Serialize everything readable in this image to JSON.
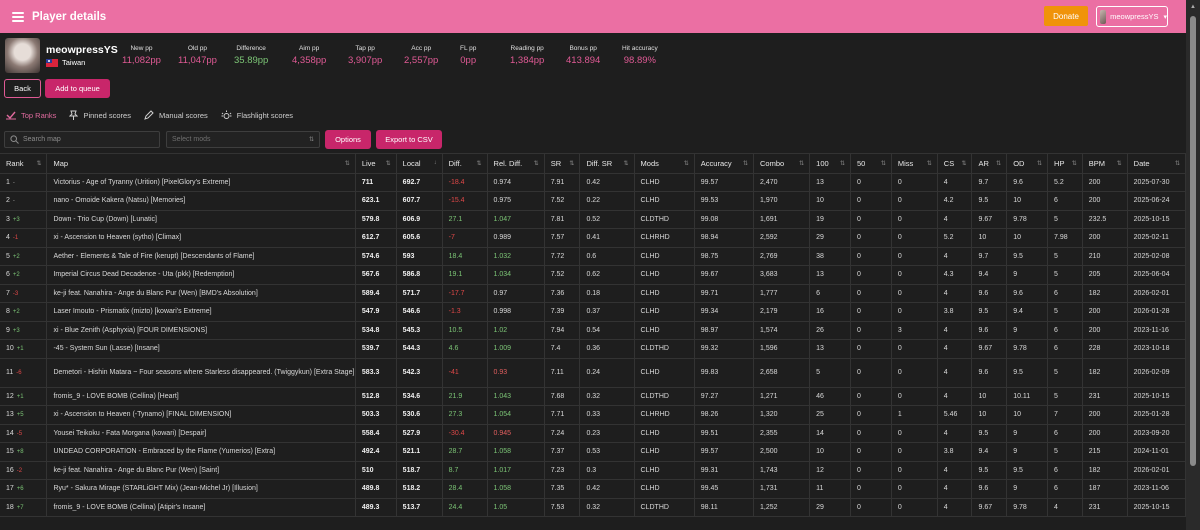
{
  "header": {
    "title": "Player details",
    "donate_label": "Donate",
    "user_label": "meowpressYS"
  },
  "profile": {
    "username": "meowpressYS",
    "country": "Taiwan",
    "stats": [
      {
        "label": "New pp",
        "value": "11,082pp",
        "tone": "pink"
      },
      {
        "label": "Old pp",
        "value": "11,047pp",
        "tone": "pink"
      },
      {
        "label": "Difference",
        "value": "35.89pp",
        "tone": "green"
      },
      {
        "label": "Aim pp",
        "value": "4,358pp",
        "tone": "pink"
      },
      {
        "label": "Tap pp",
        "value": "3,907pp",
        "tone": "pink"
      },
      {
        "label": "Acc pp",
        "value": "2,557pp",
        "tone": "pink"
      },
      {
        "label": "FL pp",
        "value": "0pp",
        "tone": "pink"
      },
      {
        "label": "Reading pp",
        "value": "1,384pp",
        "tone": "pink"
      },
      {
        "label": "Bonus pp",
        "value": "413.894",
        "tone": "pink"
      },
      {
        "label": "Hit accuracy",
        "value": "98.89%",
        "tone": "pink"
      }
    ]
  },
  "actions": {
    "back_label": "Back",
    "queue_label": "Add to queue"
  },
  "tabs": [
    {
      "label": "Top Ranks",
      "icon": "top-ranks-icon",
      "active": true
    },
    {
      "label": "Pinned scores",
      "icon": "pin-icon",
      "active": false
    },
    {
      "label": "Manual scores",
      "icon": "pencil-icon",
      "active": false
    },
    {
      "label": "Flashlight scores",
      "icon": "flashlight-icon",
      "active": false
    }
  ],
  "toolbar": {
    "search_placeholder": "Search map",
    "mods_placeholder": "Select mods",
    "options_label": "Options",
    "export_label": "Export to CSV"
  },
  "table": {
    "columns": [
      "Rank",
      "Map",
      "Live",
      "Local",
      "Diff.",
      "Rel. Diff.",
      "SR",
      "Diff. SR",
      "Mods",
      "Accuracy",
      "Combo",
      "100",
      "50",
      "Miss",
      "CS",
      "AR",
      "OD",
      "HP",
      "BPM",
      "Date"
    ],
    "rows": [
      {
        "rank": "1",
        "delta": "-",
        "dir": "same",
        "map": "Victorius - Age of Tyranny (Urition) [PixelGlory's Extreme]",
        "live": "711",
        "local": "692.7",
        "diff": "-18.4",
        "rel": "0.974",
        "sr": "7.91",
        "dsr": "0.42",
        "mods": "CLHD",
        "acc": "99.57",
        "combo": "2,470",
        "c100": "13",
        "c50": "0",
        "miss": "0",
        "cs": "4",
        "ar": "9.7",
        "od": "9.6",
        "hp": "5.2",
        "bpm": "200",
        "date": "2025-07-30"
      },
      {
        "rank": "2",
        "delta": "-",
        "dir": "same",
        "map": "nano - Omoide Kakera (Natsu) [Memories]",
        "live": "623.1",
        "local": "607.7",
        "diff": "-15.4",
        "rel": "0.975",
        "sr": "7.52",
        "dsr": "0.22",
        "mods": "CLHD",
        "acc": "99.53",
        "combo": "1,970",
        "c100": "10",
        "c50": "0",
        "miss": "0",
        "cs": "4.2",
        "ar": "9.5",
        "od": "10",
        "hp": "6",
        "bpm": "200",
        "date": "2025-06-24"
      },
      {
        "rank": "3",
        "delta": "+3",
        "dir": "up",
        "map": "Down - Trio Cup (Down) [Lunatic]",
        "live": "579.8",
        "local": "606.9",
        "diff": "27.1",
        "rel": "1.047",
        "sr": "7.81",
        "dsr": "0.52",
        "mods": "CLDTHD",
        "acc": "99.08",
        "combo": "1,691",
        "c100": "19",
        "c50": "0",
        "miss": "0",
        "cs": "4",
        "ar": "9.67",
        "od": "9.78",
        "hp": "5",
        "bpm": "232.5",
        "date": "2025-10-15"
      },
      {
        "rank": "4",
        "delta": "-1",
        "dir": "down",
        "map": "xi - Ascension to Heaven (sytho) [Climax]",
        "live": "612.7",
        "local": "605.6",
        "diff": "-7",
        "rel": "0.989",
        "sr": "7.57",
        "dsr": "0.41",
        "mods": "CLHRHD",
        "acc": "98.94",
        "combo": "2,592",
        "c100": "29",
        "c50": "0",
        "miss": "0",
        "cs": "5.2",
        "ar": "10",
        "od": "10",
        "hp": "7.98",
        "bpm": "200",
        "date": "2025-02-11"
      },
      {
        "rank": "5",
        "delta": "+2",
        "dir": "up",
        "map": "Aether - Elements & Tale of Fire (kerupt) [Descendants of Flame]",
        "live": "574.6",
        "local": "593",
        "diff": "18.4",
        "rel": "1.032",
        "sr": "7.72",
        "dsr": "0.6",
        "mods": "CLHD",
        "acc": "98.75",
        "combo": "2,769",
        "c100": "38",
        "c50": "0",
        "miss": "0",
        "cs": "4",
        "ar": "9.7",
        "od": "9.5",
        "hp": "5",
        "bpm": "210",
        "date": "2025-02-08"
      },
      {
        "rank": "6",
        "delta": "+2",
        "dir": "up",
        "map": "Imperial Circus Dead Decadence - Uta (pkk) [Redemption]",
        "live": "567.6",
        "local": "586.8",
        "diff": "19.1",
        "rel": "1.034",
        "sr": "7.52",
        "dsr": "0.62",
        "mods": "CLHD",
        "acc": "99.67",
        "combo": "3,683",
        "c100": "13",
        "c50": "0",
        "miss": "0",
        "cs": "4.3",
        "ar": "9.4",
        "od": "9",
        "hp": "5",
        "bpm": "205",
        "date": "2025-06-04"
      },
      {
        "rank": "7",
        "delta": "-3",
        "dir": "down",
        "map": "ke-ji feat. Nanahira - Ange du Blanc Pur (Wen) [BMD's Absolution]",
        "live": "589.4",
        "local": "571.7",
        "diff": "-17.7",
        "rel": "0.97",
        "sr": "7.36",
        "dsr": "0.18",
        "mods": "CLHD",
        "acc": "99.71",
        "combo": "1,777",
        "c100": "6",
        "c50": "0",
        "miss": "0",
        "cs": "4",
        "ar": "9.6",
        "od": "9.6",
        "hp": "6",
        "bpm": "182",
        "date": "2026-02-01"
      },
      {
        "rank": "8",
        "delta": "+2",
        "dir": "up",
        "map": "Laser Imouto - Prismatix (mizto) [kowari's Extreme]",
        "live": "547.9",
        "local": "546.6",
        "diff": "-1.3",
        "rel": "0.998",
        "sr": "7.39",
        "dsr": "0.37",
        "mods": "CLHD",
        "acc": "99.34",
        "combo": "2,179",
        "c100": "16",
        "c50": "0",
        "miss": "0",
        "cs": "3.8",
        "ar": "9.5",
        "od": "9.4",
        "hp": "5",
        "bpm": "200",
        "date": "2026-01-28"
      },
      {
        "rank": "9",
        "delta": "+3",
        "dir": "up",
        "map": "xi - Blue Zenith (Asphyxia) [FOUR DIMENSIONS]",
        "live": "534.8",
        "local": "545.3",
        "diff": "10.5",
        "rel": "1.02",
        "sr": "7.94",
        "dsr": "0.54",
        "mods": "CLHD",
        "acc": "98.97",
        "combo": "1,574",
        "c100": "26",
        "c50": "0",
        "miss": "3",
        "cs": "4",
        "ar": "9.6",
        "od": "9",
        "hp": "6",
        "bpm": "200",
        "date": "2023-11-16"
      },
      {
        "rank": "10",
        "delta": "+1",
        "dir": "up",
        "map": "-45 - System Sun (Lasse) [Insane]",
        "live": "539.7",
        "local": "544.3",
        "diff": "4.6",
        "rel": "1.009",
        "sr": "7.4",
        "dsr": "0.36",
        "mods": "CLDTHD",
        "acc": "99.32",
        "combo": "1,596",
        "c100": "13",
        "c50": "0",
        "miss": "0",
        "cs": "4",
        "ar": "9.67",
        "od": "9.78",
        "hp": "6",
        "bpm": "228",
        "date": "2023-10-18"
      },
      {
        "rank": "11",
        "delta": "-6",
        "dir": "down",
        "map": "Demetori - Hishin Matara ~ Four seasons where Starless disappeared. (Twiggykun) [Extra Stage]",
        "live": "583.3",
        "local": "542.3",
        "diff": "-41",
        "rel": "0.93",
        "sr": "7.11",
        "dsr": "0.24",
        "mods": "CLHD",
        "acc": "99.83",
        "combo": "2,658",
        "c100": "5",
        "c50": "0",
        "miss": "0",
        "cs": "4",
        "ar": "9.6",
        "od": "9.5",
        "hp": "5",
        "bpm": "182",
        "date": "2026-02-09",
        "tall": true
      },
      {
        "rank": "12",
        "delta": "+1",
        "dir": "up",
        "map": "fromis_9 - LOVE BOMB (Cellina) [Heart]",
        "live": "512.8",
        "local": "534.6",
        "diff": "21.9",
        "rel": "1.043",
        "sr": "7.68",
        "dsr": "0.32",
        "mods": "CLDTHD",
        "acc": "97.27",
        "combo": "1,271",
        "c100": "46",
        "c50": "0",
        "miss": "0",
        "cs": "4",
        "ar": "10",
        "od": "10.11",
        "hp": "5",
        "bpm": "231",
        "date": "2025-10-15"
      },
      {
        "rank": "13",
        "delta": "+5",
        "dir": "up",
        "map": "xi - Ascension to Heaven (-Tynamo) [FINAL DIMENSION]",
        "live": "503.3",
        "local": "530.6",
        "diff": "27.3",
        "rel": "1.054",
        "sr": "7.71",
        "dsr": "0.33",
        "mods": "CLHRHD",
        "acc": "98.26",
        "combo": "1,320",
        "c100": "25",
        "c50": "0",
        "miss": "1",
        "cs": "5.46",
        "ar": "10",
        "od": "10",
        "hp": "7",
        "bpm": "200",
        "date": "2025-01-28"
      },
      {
        "rank": "14",
        "delta": "-5",
        "dir": "down",
        "map": "Yousei Teikoku - Fata Morgana (kowari) [Despair]",
        "live": "558.4",
        "local": "527.9",
        "diff": "-30.4",
        "rel": "0.945",
        "sr": "7.24",
        "dsr": "0.23",
        "mods": "CLHD",
        "acc": "99.51",
        "combo": "2,355",
        "c100": "14",
        "c50": "0",
        "miss": "0",
        "cs": "4",
        "ar": "9.5",
        "od": "9",
        "hp": "6",
        "bpm": "200",
        "date": "2023-09-20"
      },
      {
        "rank": "15",
        "delta": "+8",
        "dir": "up",
        "map": "UNDEAD CORPORATION - Embraced by the Flame (Yumerios) [Extra]",
        "live": "492.4",
        "local": "521.1",
        "diff": "28.7",
        "rel": "1.058",
        "sr": "7.37",
        "dsr": "0.53",
        "mods": "CLHD",
        "acc": "99.57",
        "combo": "2,500",
        "c100": "10",
        "c50": "0",
        "miss": "0",
        "cs": "3.8",
        "ar": "9.4",
        "od": "9",
        "hp": "5",
        "bpm": "215",
        "date": "2024-11-01"
      },
      {
        "rank": "16",
        "delta": "-2",
        "dir": "down",
        "map": "ke-ji feat. Nanahira - Ange du Blanc Pur (Wen) [Saint]",
        "live": "510",
        "local": "518.7",
        "diff": "8.7",
        "rel": "1.017",
        "sr": "7.23",
        "dsr": "0.3",
        "mods": "CLHD",
        "acc": "99.31",
        "combo": "1,743",
        "c100": "12",
        "c50": "0",
        "miss": "0",
        "cs": "4",
        "ar": "9.5",
        "od": "9.5",
        "hp": "6",
        "bpm": "182",
        "date": "2026-02-01"
      },
      {
        "rank": "17",
        "delta": "+6",
        "dir": "up",
        "map": "Ryu* - Sakura Mirage (STARLiGHT Mix) (Jean-Michel Jr) [Illusion]",
        "live": "489.8",
        "local": "518.2",
        "diff": "28.4",
        "rel": "1.058",
        "sr": "7.35",
        "dsr": "0.42",
        "mods": "CLHD",
        "acc": "99.45",
        "combo": "1,731",
        "c100": "11",
        "c50": "0",
        "miss": "0",
        "cs": "4",
        "ar": "9.6",
        "od": "9",
        "hp": "6",
        "bpm": "187",
        "date": "2023-11-06"
      },
      {
        "rank": "18",
        "delta": "+7",
        "dir": "up",
        "map": "fromis_9 - LOVE BOMB (Cellina) [Atipir's Insane]",
        "live": "489.3",
        "local": "513.7",
        "diff": "24.4",
        "rel": "1.05",
        "sr": "7.53",
        "dsr": "0.32",
        "mods": "CLDTHD",
        "acc": "98.11",
        "combo": "1,252",
        "c100": "29",
        "c50": "0",
        "miss": "0",
        "cs": "4",
        "ar": "9.67",
        "od": "9.78",
        "hp": "4",
        "bpm": "231",
        "date": "2025-10-15"
      }
    ]
  }
}
